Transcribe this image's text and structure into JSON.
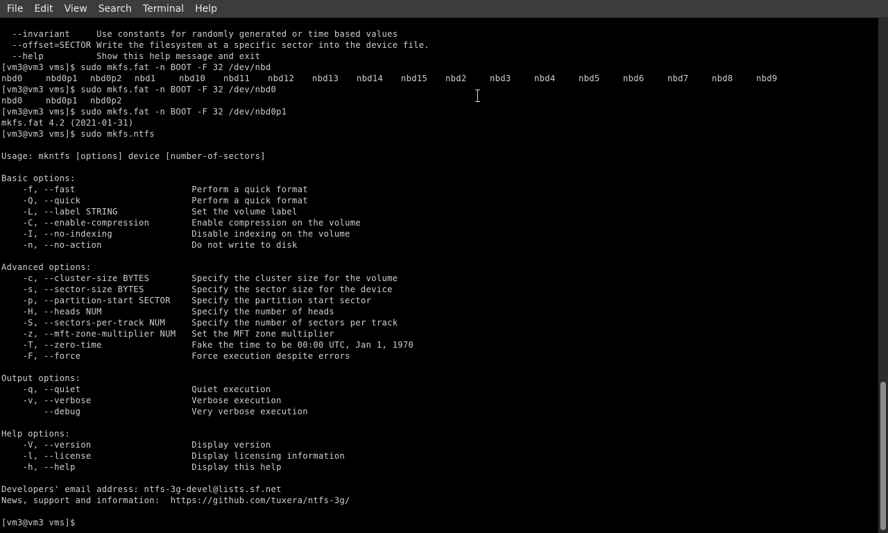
{
  "menu": [
    "File",
    "Edit",
    "View",
    "Search",
    "Terminal",
    "Help"
  ],
  "lines": [
    "  --invariant     Use constants for randomly generated or time based values",
    "  --offset=SECTOR Write the filesystem at a specific sector into the device file.",
    "  --help          Show this help message and exit",
    "[vm3@vm3 vms]$ sudo mkfs.fat -n BOOT -F 32 /dev/nbd",
    "",
    "[vm3@vm3 vms]$ sudo mkfs.fat -n BOOT -F 32 /dev/nbd0",
    "",
    "[vm3@vm3 vms]$ sudo mkfs.fat -n BOOT -F 32 /dev/nbd0p1",
    "mkfs.fat 4.2 (2021-01-31)",
    "[vm3@vm3 vms]$ sudo mkfs.ntfs",
    "",
    "Usage: mkntfs [options] device [number-of-sectors]",
    "",
    "Basic options:",
    "    -f, --fast                      Perform a quick format",
    "    -Q, --quick                     Perform a quick format",
    "    -L, --label STRING              Set the volume label",
    "    -C, --enable-compression        Enable compression on the volume",
    "    -I, --no-indexing               Disable indexing on the volume",
    "    -n, --no-action                 Do not write to disk",
    "",
    "Advanced options:",
    "    -c, --cluster-size BYTES        Specify the cluster size for the volume",
    "    -s, --sector-size BYTES         Specify the sector size for the device",
    "    -p, --partition-start SECTOR    Specify the partition start sector",
    "    -H, --heads NUM                 Specify the number of heads",
    "    -S, --sectors-per-track NUM     Specify the number of sectors per track",
    "    -z, --mft-zone-multiplier NUM   Set the MFT zone multiplier",
    "    -T, --zero-time                 Fake the time to be 00:00 UTC, Jan 1, 1970",
    "    -F, --force                     Force execution despite errors",
    "",
    "Output options:",
    "    -q, --quiet                     Quiet execution",
    "    -v, --verbose                   Verbose execution",
    "        --debug                     Very verbose execution",
    "",
    "Help options:",
    "    -V, --version                   Display version",
    "    -l, --license                   Display licensing information",
    "    -h, --help                      Display this help",
    "",
    "Developers' email address: ntfs-3g-devel@lists.sf.net",
    "News, support and information:  https://github.com/tuxera/ntfs-3g/",
    "",
    "[vm3@vm3 vms]$ "
  ],
  "completions": [
    {
      "line": 4,
      "items": [
        "nbd0",
        "nbd0p1",
        "nbd0p2",
        "nbd1",
        "nbd10",
        "nbd11",
        "nbd12",
        "nbd13",
        "nbd14",
        "nbd15",
        "nbd2",
        "nbd3",
        "nbd4",
        "nbd5",
        "nbd6",
        "nbd7",
        "nbd8",
        "nbd9"
      ]
    },
    {
      "line": 6,
      "items": [
        "nbd0",
        "nbd0p1",
        "nbd0p2"
      ]
    }
  ]
}
